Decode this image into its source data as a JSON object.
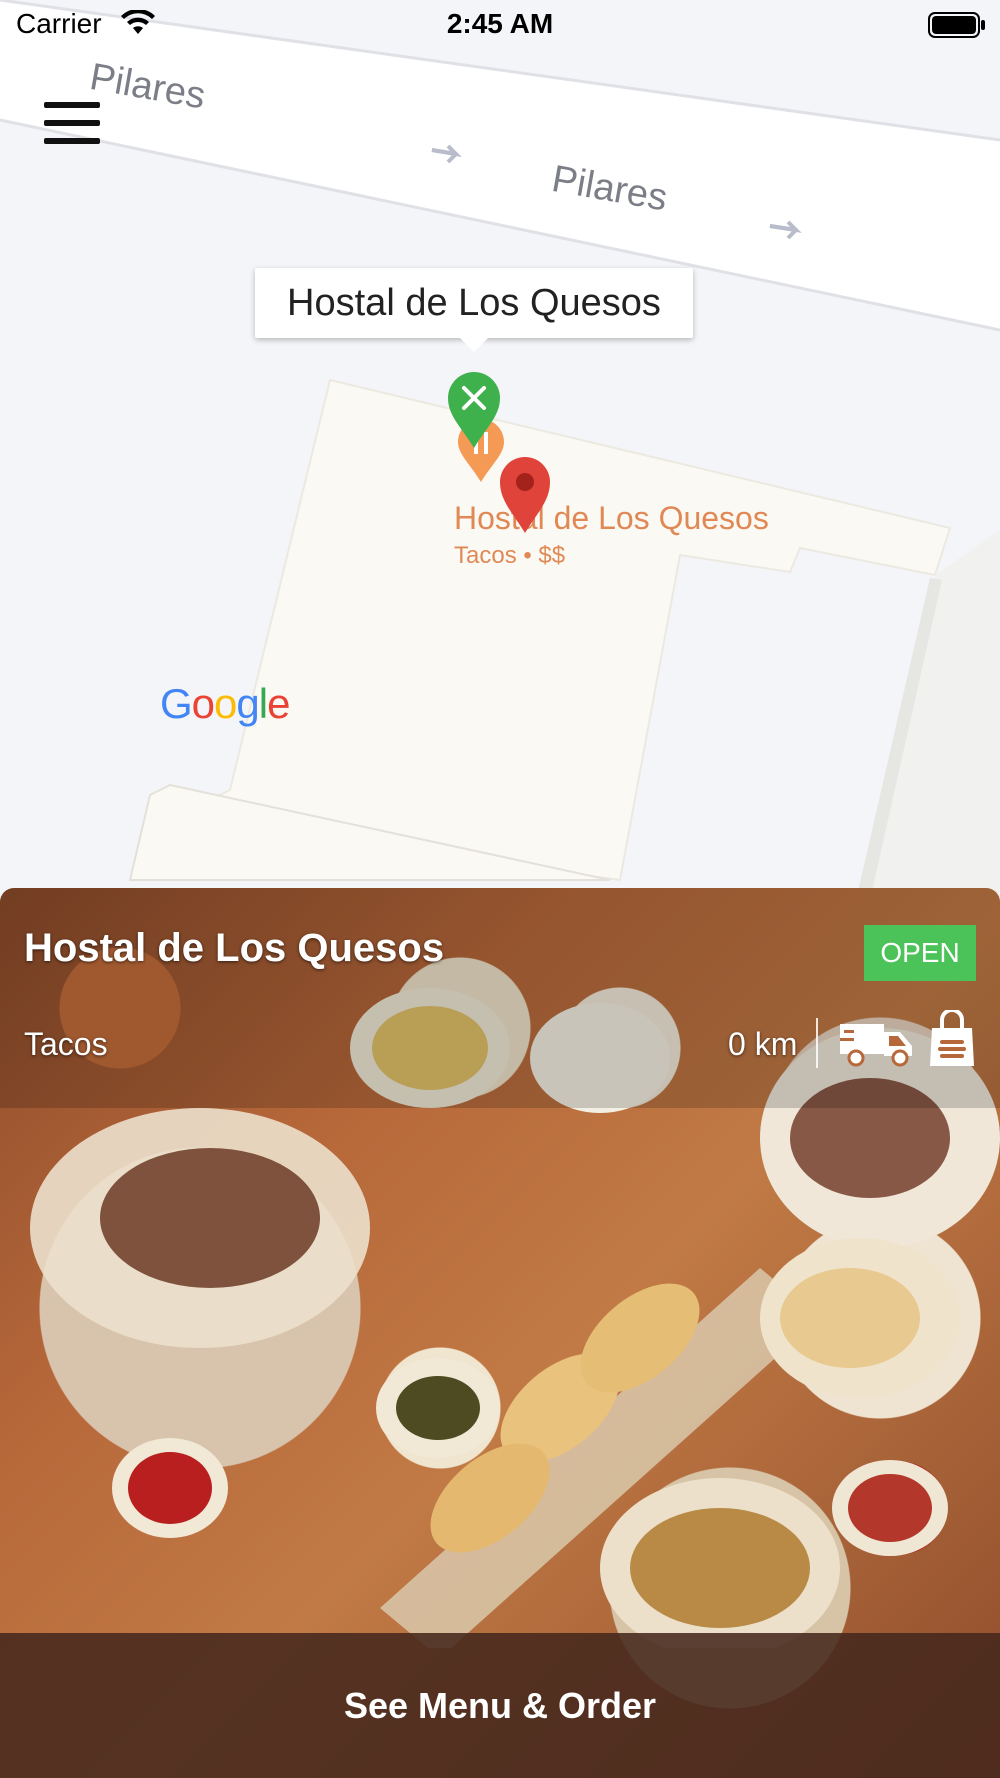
{
  "status_bar": {
    "carrier": "Carrier",
    "time": "2:45 AM"
  },
  "map": {
    "road_labels": [
      "Pilares",
      "Pilares"
    ],
    "info_window_title": "Hostal de Los Quesos",
    "poi_name": "Hostal de Los Quesos",
    "poi_subtitle": "Tacos • $$",
    "attribution": "Google"
  },
  "restaurant": {
    "name": "Hostal de Los Quesos",
    "status": "OPEN",
    "cuisine": "Tacos",
    "distance": "0 km"
  },
  "order_button": {
    "label": "See Menu & Order"
  },
  "colors": {
    "open_badge": "#4cc359",
    "pin_green": "#3fb14c",
    "pin_red": "#e0433a",
    "poi_text": "#e08955"
  },
  "icons": [
    "wifi-icon",
    "battery-icon",
    "hamburger-menu-icon",
    "restaurant-pin-icon",
    "map-marker-icon",
    "delivery-truck-icon",
    "takeout-bag-icon"
  ]
}
